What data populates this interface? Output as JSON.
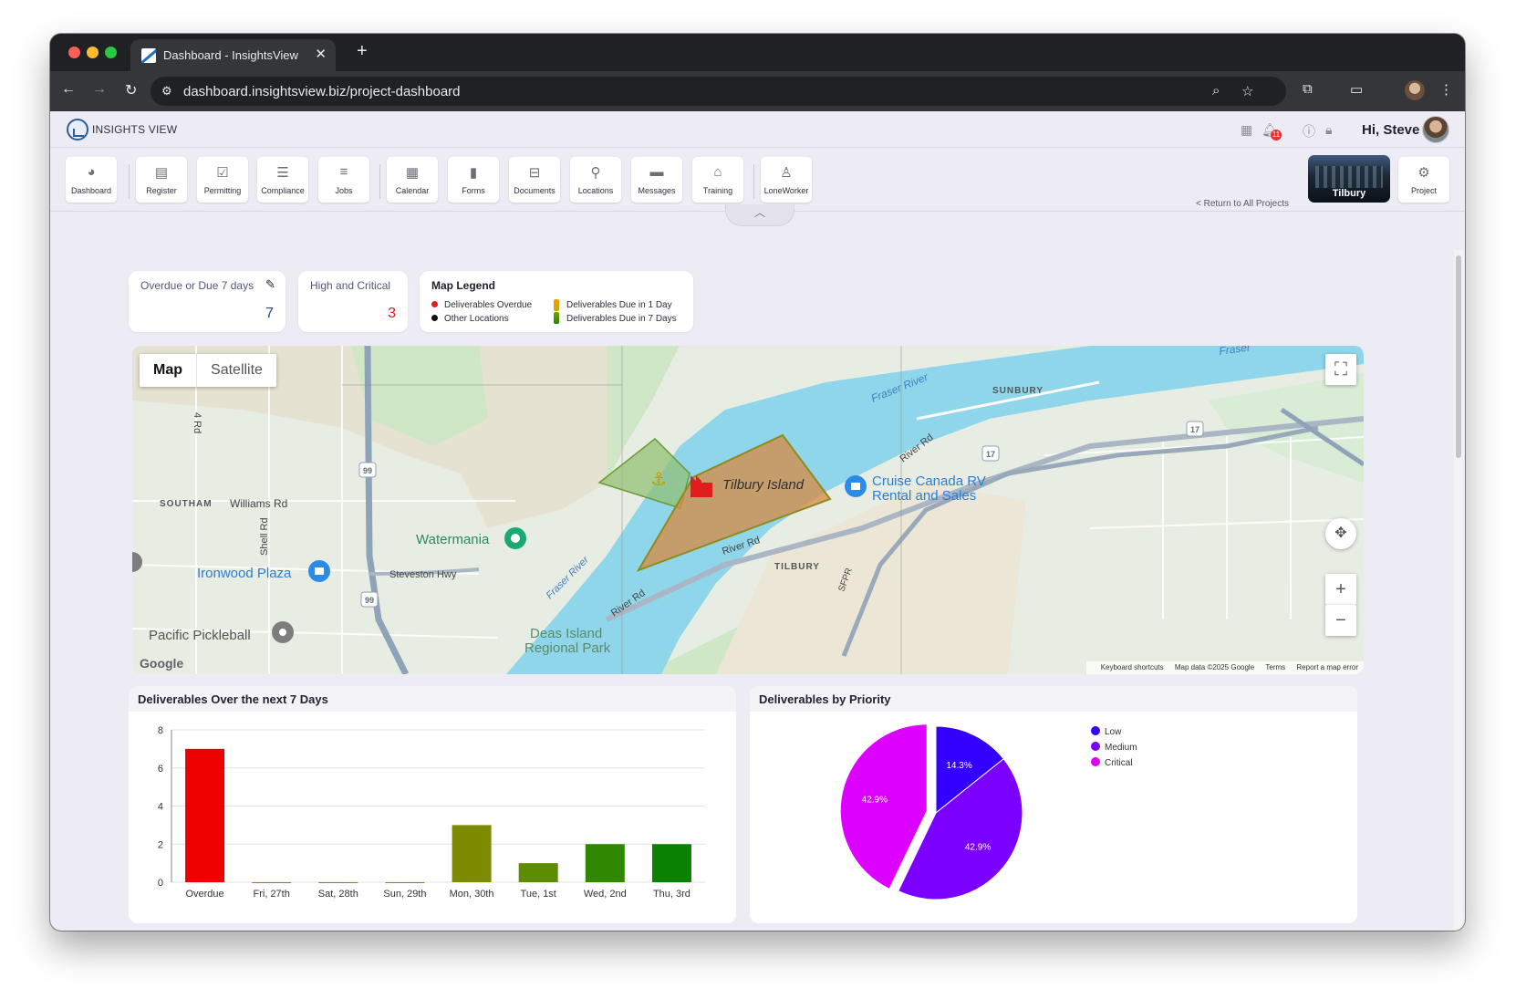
{
  "browser": {
    "tab_title": "Dashboard - InsightsView",
    "url": "dashboard.insightsview.biz/project-dashboard"
  },
  "header": {
    "logo_text": "INSIGHTS VIEW",
    "notification_count": "11",
    "greeting": "Hi, Steve"
  },
  "modules": {
    "dashboard": "Dashboard",
    "register": "Register",
    "permitting": "Permitting",
    "compliance": "Compliance",
    "jobs": "Jobs",
    "calendar": "Calendar",
    "forms": "Forms",
    "documents": "Documents",
    "locations": "Locations",
    "messages": "Messages",
    "training": "Training",
    "loneworker": "LoneWorker",
    "return_link": "< Return to All Projects",
    "project_name": "Tilbury",
    "project_settings": "Project"
  },
  "stats": {
    "overdue": {
      "title": "Overdue or Due 7 days",
      "value": "7"
    },
    "high_critical": {
      "title": "High and Critical",
      "value": "3"
    }
  },
  "legend": {
    "title": "Map Legend",
    "overdue": "Deliverables Overdue",
    "other": "Other Locations",
    "due1": "Deliverables Due in 1 Day",
    "due7": "Deliverables Due in 7 Days"
  },
  "map": {
    "map_tab": "Map",
    "satellite_tab": "Satellite",
    "labels": {
      "fraser_top": "Fraser",
      "fraser_river": "Fraser River",
      "sunbury": "SUNBURY",
      "river_rd_1": "River Rd",
      "river_rd_2": "River Rd",
      "river_rd_3": "River Rd",
      "tilbury_island": "Tilbury Island",
      "cruise_canada_1": "Cruise Canada RV",
      "cruise_canada_2": "Rental and Sales",
      "southam": "SOUTHAM",
      "williams_rd": "Williams Rd",
      "shell_rd": "Shell Rd",
      "rd_4": "4 Rd",
      "watermania": "Watermania",
      "steveston_hwy": "Steveston Hwy",
      "ironwood_plaza": "Ironwood Plaza",
      "fraser_river_2": "Fraser River",
      "tilbury": "TILBURY",
      "sfpr": "SFPR",
      "deas_island_1": "Deas Island",
      "deas_island_2": "Regional Park",
      "pacific_pickleball": "Pacific Pickleball",
      "hwy_99a": "99",
      "hwy_99b": "99",
      "hwy_17a": "17",
      "hwy_17b": "17"
    },
    "google": "Google",
    "attribution": {
      "shortcuts": "Keyboard shortcuts",
      "data": "Map data ©2025 Google",
      "terms": "Terms",
      "report": "Report a map error"
    }
  },
  "colors": {
    "overdue_red": "#ee0000",
    "low": "#3300ff",
    "medium": "#7b00ff",
    "critical": "#dd00ff",
    "stat_blue": "#2c3e8f",
    "stat_red": "#d91a1a"
  },
  "bar_chart_title": "Deliverables Over the next 7 Days",
  "pie_chart_title": "Deliverables by Priority",
  "chart_data": [
    {
      "type": "bar",
      "title": "Deliverables Over the next 7 Days",
      "categories": [
        "Overdue",
        "Fri, 27th",
        "Sat, 28th",
        "Sun, 29th",
        "Mon, 30th",
        "Tue, 1st",
        "Wed, 2nd",
        "Thu, 3rd"
      ],
      "values": [
        7,
        0,
        0,
        0,
        3,
        1,
        2,
        2
      ],
      "colors": [
        "#ee0000",
        "#8a8a00",
        "#8a8a00",
        "#8a8a00",
        "#7e8b00",
        "#5e8c00",
        "#2f8800",
        "#0a8200"
      ],
      "yticks": [
        "0",
        "2",
        "4",
        "6",
        "8"
      ],
      "ylim": [
        0,
        8
      ],
      "grid": true
    },
    {
      "type": "pie",
      "title": "Deliverables by Priority",
      "labels": [
        "Low",
        "Medium",
        "Critical"
      ],
      "values": [
        14.3,
        42.9,
        42.9
      ],
      "value_labels": [
        "14.3%",
        "42.9%",
        "42.9%"
      ],
      "colors": [
        "#3300ff",
        "#7b00ff",
        "#dd00ff"
      ],
      "exploded": "Critical",
      "legend": "right"
    }
  ]
}
